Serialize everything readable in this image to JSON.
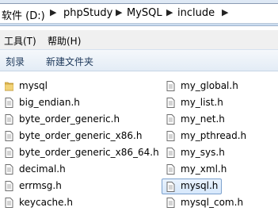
{
  "address": {
    "crumbs": [
      "软件 (D:)",
      "phpStudy",
      "MySQL",
      "include"
    ]
  },
  "menu": {
    "items": [
      "工具(T)",
      "帮助(H)"
    ]
  },
  "commands": {
    "items": [
      "刻录",
      "新建文件夹"
    ]
  },
  "files": {
    "left": [
      "mysql",
      "big_endian.h",
      "byte_order_generic.h",
      "byte_order_generic_x86.h",
      "byte_order_generic_x86_64.h",
      "decimal.h",
      "errmsg.h",
      "keycache.h"
    ],
    "right": [
      "my_global.h",
      "my_list.h",
      "my_net.h",
      "my_pthread.h",
      "my_sys.h",
      "my_xml.h",
      "mysql.h",
      "mysql_com.h"
    ],
    "selected": "mysql.h"
  },
  "colors": {
    "folder": "#e8c15a",
    "selection_border": "#7da2ce",
    "command_text": "#1e395b"
  },
  "icons": {
    "folder": "folder-icon",
    "file": "header-file-icon",
    "separator": "chevron-right-icon"
  }
}
